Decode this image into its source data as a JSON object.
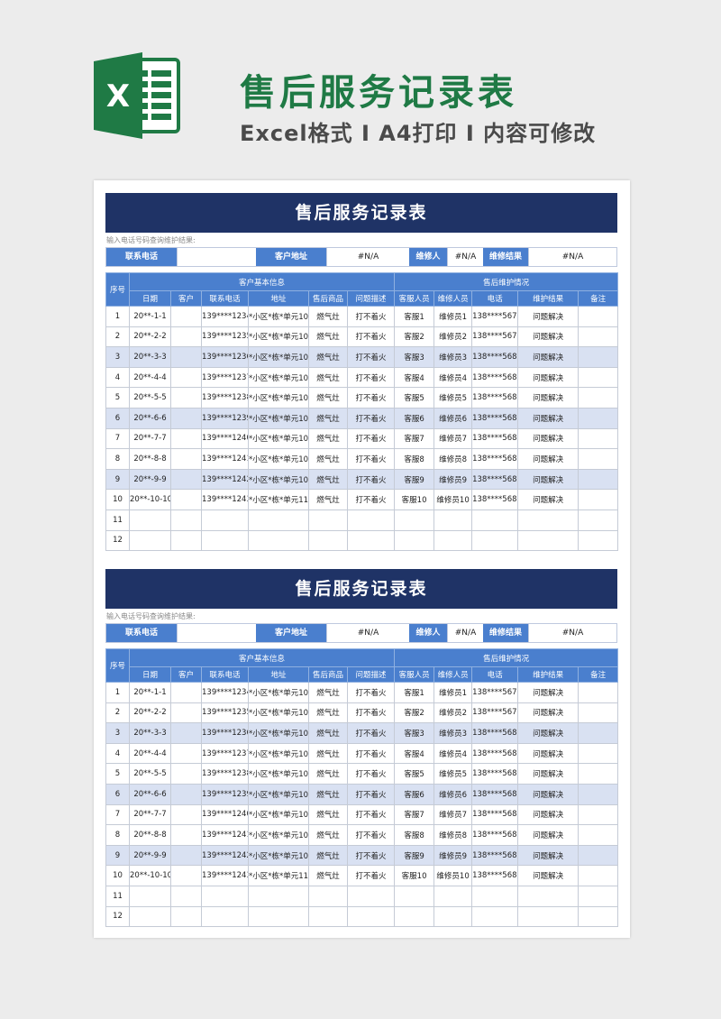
{
  "header": {
    "title": "售后服务记录表",
    "subtitle": "Excel格式 Ⅰ A4打印 Ⅰ 内容可修改",
    "logo_letter": "X",
    "colors": {
      "excel_green": "#1f7a45",
      "navy": "#1f3366",
      "blue": "#4a7fce",
      "shade": "#d9e1f2"
    }
  },
  "sheets": [
    {
      "title": "售后服务记录表",
      "hint": "输入电话号码查询维护结果:",
      "query": {
        "phone_label": "联系电话",
        "phone_value": "",
        "address_label": "客户地址",
        "address_value": "#N/A",
        "tech_label": "维修人",
        "tech_value": "#N/A",
        "result_label": "维修结果",
        "result_value": "#N/A"
      },
      "group_headers": [
        "序号",
        "客户基本信息",
        "售后维护情况"
      ],
      "columns": [
        "日期",
        "客户",
        "联系电话",
        "地址",
        "售后商品",
        "问题描述",
        "客服人员",
        "维修人员",
        "电话",
        "维护结果",
        "备注"
      ],
      "rows": [
        [
          "1",
          "20**-1-1",
          "",
          "139****1234",
          "*小区*栋*单元101",
          "燃气灶",
          "打不着火",
          "客服1",
          "维修员1",
          "138****5678",
          "问题解决",
          ""
        ],
        [
          "2",
          "20**-2-2",
          "",
          "139****1235",
          "*小区*栋*单元102",
          "燃气灶",
          "打不着火",
          "客服2",
          "维修员2",
          "138****5679",
          "问题解决",
          ""
        ],
        [
          "3",
          "20**-3-3",
          "",
          "139****1236",
          "*小区*栋*单元103",
          "燃气灶",
          "打不着火",
          "客服3",
          "维修员3",
          "138****5680",
          "问题解决",
          ""
        ],
        [
          "4",
          "20**-4-4",
          "",
          "139****1237",
          "*小区*栋*单元104",
          "燃气灶",
          "打不着火",
          "客服4",
          "维修员4",
          "138****5681",
          "问题解决",
          ""
        ],
        [
          "5",
          "20**-5-5",
          "",
          "139****1238",
          "*小区*栋*单元105",
          "燃气灶",
          "打不着火",
          "客服5",
          "维修员5",
          "138****5682",
          "问题解决",
          ""
        ],
        [
          "6",
          "20**-6-6",
          "",
          "139****1239",
          "*小区*栋*单元106",
          "燃气灶",
          "打不着火",
          "客服6",
          "维修员6",
          "138****5683",
          "问题解决",
          ""
        ],
        [
          "7",
          "20**-7-7",
          "",
          "139****1240",
          "*小区*栋*单元107",
          "燃气灶",
          "打不着火",
          "客服7",
          "维修员7",
          "138****5684",
          "问题解决",
          ""
        ],
        [
          "8",
          "20**-8-8",
          "",
          "139****1241",
          "*小区*栋*单元108",
          "燃气灶",
          "打不着火",
          "客服8",
          "维修员8",
          "138****5685",
          "问题解决",
          ""
        ],
        [
          "9",
          "20**-9-9",
          "",
          "139****1242",
          "*小区*栋*单元109",
          "燃气灶",
          "打不着火",
          "客服9",
          "维修员9",
          "138****5686",
          "问题解决",
          ""
        ],
        [
          "10",
          "20**-10-10",
          "",
          "139****1243",
          "*小区*栋*单元110",
          "燃气灶",
          "打不着火",
          "客服10",
          "维修员10",
          "138****5687",
          "问题解决",
          ""
        ],
        [
          "11",
          "",
          "",
          "",
          "",
          "",
          "",
          "",
          "",
          "",
          "",
          ""
        ],
        [
          "12",
          "",
          "",
          "",
          "",
          "",
          "",
          "",
          "",
          "",
          "",
          ""
        ]
      ]
    },
    {
      "title": "售后服务记录表",
      "hint": "输入电话号码查询维护结果:",
      "query": {
        "phone_label": "联系电话",
        "phone_value": "",
        "address_label": "客户地址",
        "address_value": "#N/A",
        "tech_label": "维修人",
        "tech_value": "#N/A",
        "result_label": "维修结果",
        "result_value": "#N/A"
      },
      "group_headers": [
        "序号",
        "客户基本信息",
        "售后维护情况"
      ],
      "columns": [
        "日期",
        "客户",
        "联系电话",
        "地址",
        "售后商品",
        "问题描述",
        "客服人员",
        "维修人员",
        "电话",
        "维护结果",
        "备注"
      ],
      "rows": [
        [
          "1",
          "20**-1-1",
          "",
          "139****1234",
          "*小区*栋*单元101",
          "燃气灶",
          "打不着火",
          "客服1",
          "维修员1",
          "138****5678",
          "问题解决",
          ""
        ],
        [
          "2",
          "20**-2-2",
          "",
          "139****1235",
          "*小区*栋*单元102",
          "燃气灶",
          "打不着火",
          "客服2",
          "维修员2",
          "138****5679",
          "问题解决",
          ""
        ],
        [
          "3",
          "20**-3-3",
          "",
          "139****1236",
          "*小区*栋*单元103",
          "燃气灶",
          "打不着火",
          "客服3",
          "维修员3",
          "138****5680",
          "问题解决",
          ""
        ],
        [
          "4",
          "20**-4-4",
          "",
          "139****1237",
          "*小区*栋*单元104",
          "燃气灶",
          "打不着火",
          "客服4",
          "维修员4",
          "138****5681",
          "问题解决",
          ""
        ],
        [
          "5",
          "20**-5-5",
          "",
          "139****1238",
          "*小区*栋*单元105",
          "燃气灶",
          "打不着火",
          "客服5",
          "维修员5",
          "138****5682",
          "问题解决",
          ""
        ],
        [
          "6",
          "20**-6-6",
          "",
          "139****1239",
          "*小区*栋*单元106",
          "燃气灶",
          "打不着火",
          "客服6",
          "维修员6",
          "138****5683",
          "问题解决",
          ""
        ],
        [
          "7",
          "20**-7-7",
          "",
          "139****1240",
          "*小区*栋*单元107",
          "燃气灶",
          "打不着火",
          "客服7",
          "维修员7",
          "138****5684",
          "问题解决",
          ""
        ],
        [
          "8",
          "20**-8-8",
          "",
          "139****1241",
          "*小区*栋*单元108",
          "燃气灶",
          "打不着火",
          "客服8",
          "维修员8",
          "138****5685",
          "问题解决",
          ""
        ],
        [
          "9",
          "20**-9-9",
          "",
          "139****1242",
          "*小区*栋*单元109",
          "燃气灶",
          "打不着火",
          "客服9",
          "维修员9",
          "138****5686",
          "问题解决",
          ""
        ],
        [
          "10",
          "20**-10-10",
          "",
          "139****1243",
          "*小区*栋*单元110",
          "燃气灶",
          "打不着火",
          "客服10",
          "维修员10",
          "138****5687",
          "问题解决",
          ""
        ],
        [
          "11",
          "",
          "",
          "",
          "",
          "",
          "",
          "",
          "",
          "",
          "",
          ""
        ],
        [
          "12",
          "",
          "",
          "",
          "",
          "",
          "",
          "",
          "",
          "",
          "",
          ""
        ]
      ]
    }
  ]
}
